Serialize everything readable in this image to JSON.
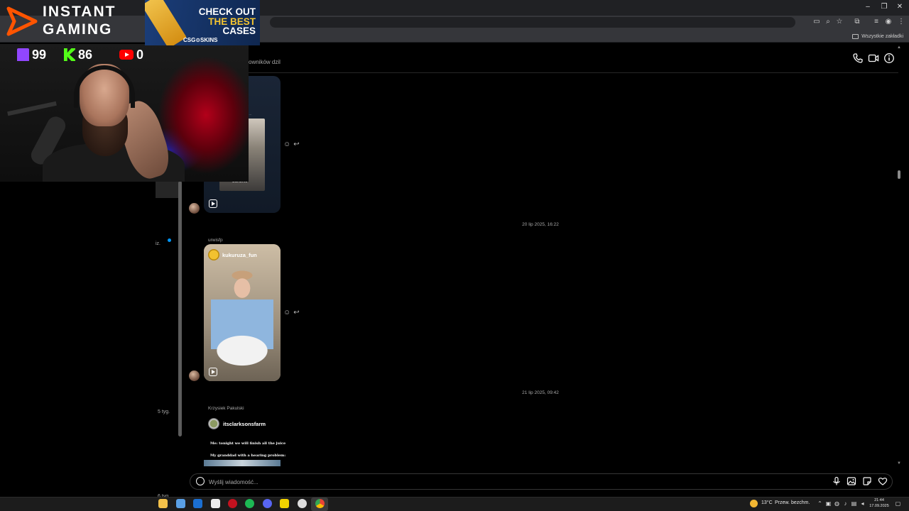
{
  "browser": {
    "bookmarks_folder": "Wszystkie zakładki",
    "window_controls": [
      "–",
      "❐",
      "✕"
    ]
  },
  "sidebar": {
    "snippets": [
      "iz.",
      "5 tyg.",
      "6 tyg."
    ]
  },
  "chat": {
    "header_name": "owników dzil",
    "messages": [
      {
        "kind": "reel",
        "thumb_tag": "SCREAM"
      },
      {
        "kind": "timestamp",
        "text": "20 lip 2025, 16:22"
      },
      {
        "kind": "reel",
        "sender": "urwisfp",
        "owner": "kukuruza_fun"
      },
      {
        "kind": "timestamp",
        "text": "21 lip 2025, 09:42"
      },
      {
        "kind": "reel",
        "sender": "Krzysiek Pakulski",
        "owner": "itsclarksonsfarm",
        "caption_lines": [
          "Me: tonight we will finish all the juice",
          "My granddad with a hearing problem:"
        ]
      }
    ],
    "composer": {
      "placeholder": "Wyślij wiadomość..."
    }
  },
  "taskbar": {
    "weather_temp": "13°C",
    "weather_desc": "Przew. bezchm.",
    "time": "21:44",
    "date": "17.09.2025"
  },
  "overlay": {
    "logo_line1": "INSTANT",
    "logo_line2": "GAMING",
    "ad_line1": "CHECK OUT",
    "ad_line2": "THE BEST",
    "ad_line3": "CASES",
    "ad_brand": "CSG⊙SKINS",
    "twitch_count": "99",
    "kick_count": "86",
    "youtube_count": "0"
  },
  "colors": {
    "accent_blue": "#0095f6",
    "twitch": "#9146ff",
    "kick": "#53fc18",
    "youtube": "#ff0000"
  }
}
